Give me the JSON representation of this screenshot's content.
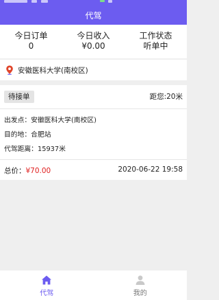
{
  "header": {
    "title": "代驾"
  },
  "stats": [
    {
      "label": "今日订单",
      "value": "0"
    },
    {
      "label": "今日收入",
      "value": "¥0.00"
    },
    {
      "label": "工作状态",
      "value": "听单中"
    }
  ],
  "location": {
    "icon": "map-pin-icon",
    "text": "安徽医科大学(南校区)"
  },
  "order": {
    "status_badge": "待接单",
    "distance_to_you": "距您:20米",
    "start_point": "出发点：安徽医科大学(南校区)",
    "destination": "目的地：合肥站",
    "drive_distance": "代驾距离：15937米",
    "total_label": "总价：",
    "total_price": "¥70.00",
    "datetime": "2020-06-22 19:58"
  },
  "tabs": [
    {
      "label": "代驾",
      "icon": "home-icon",
      "active": true
    },
    {
      "label": "我的",
      "icon": "user-icon",
      "active": false
    }
  ],
  "colors": {
    "primary": "#6c5cf0",
    "price": "#e02020",
    "pin": "#e0452a"
  }
}
